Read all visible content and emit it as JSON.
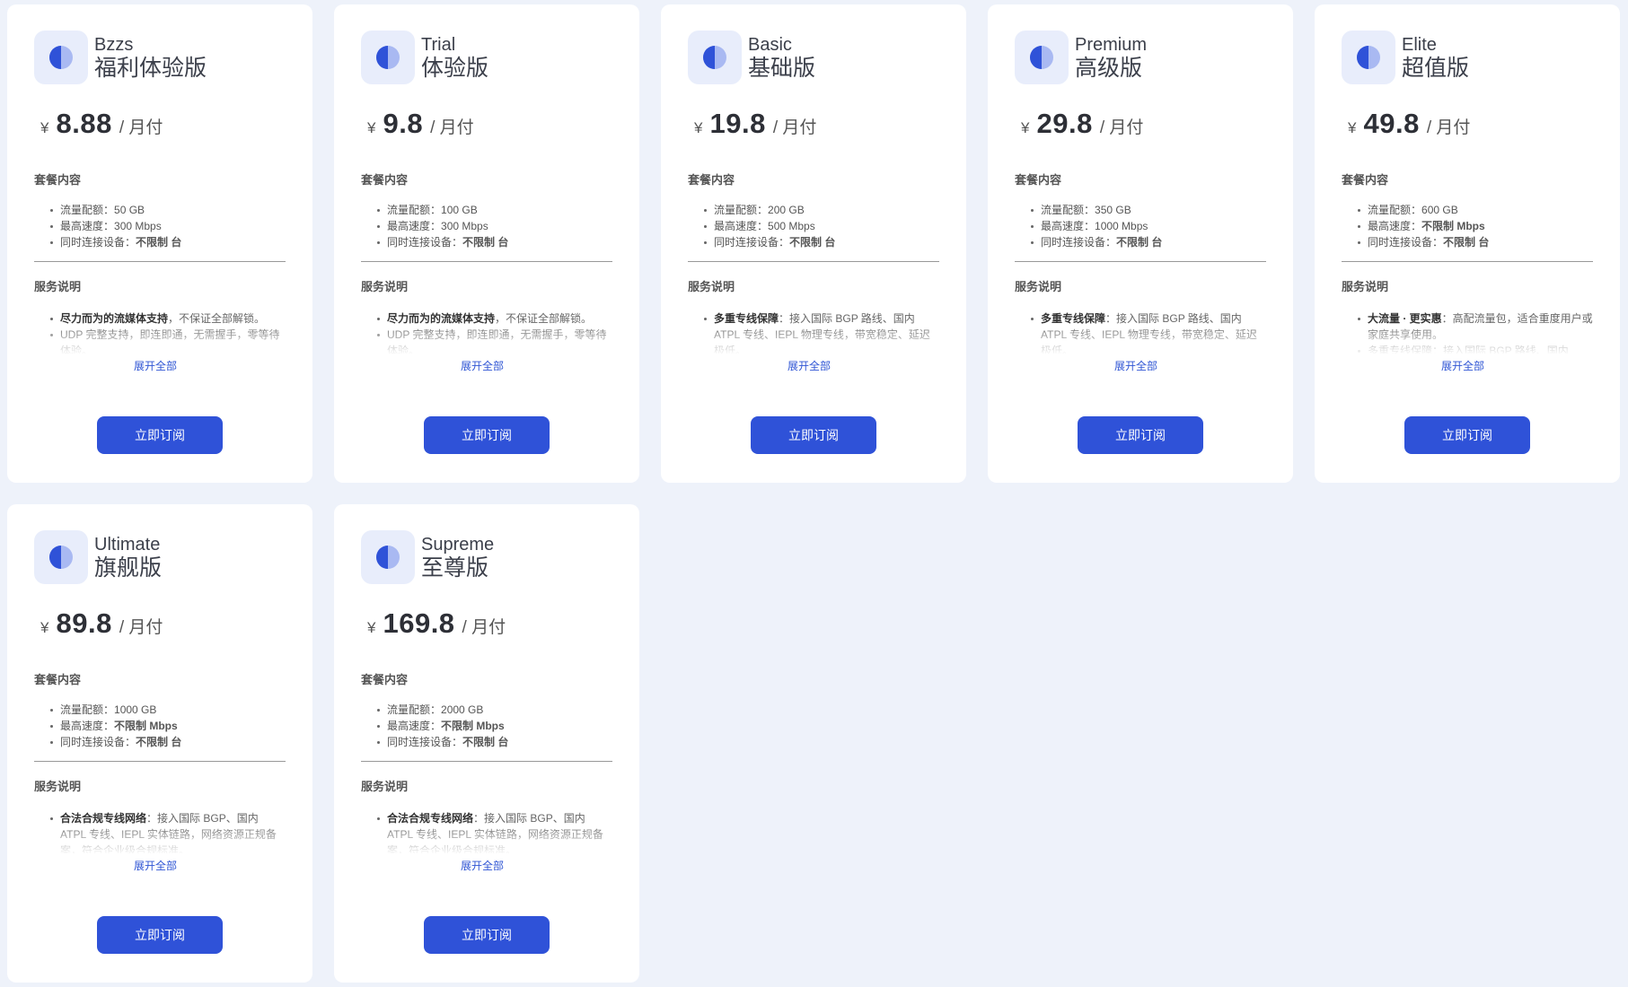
{
  "plans": [
    {
      "name_en": "Bzzs",
      "name_cn": "福利体验版",
      "currency": "¥",
      "price": "8.88",
      "period": "/ 月付",
      "contents_title": "套餐内容",
      "features": [
        {
          "label": "流量配额：",
          "value": "50 GB",
          "strong": false
        },
        {
          "label": "最高速度：",
          "value": "300 Mbps",
          "strong": false
        },
        {
          "label": "同时连接设备：",
          "value": "不限制 台",
          "strong": true
        }
      ],
      "service_title": "服务说明",
      "service_lines": [
        {
          "bold": "尽力而为的流媒体支持",
          "text": "，不保证全部解锁。"
        },
        {
          "bold": "",
          "text": "UDP 完整支持，即连即通，无需握手，零等待体验。"
        }
      ],
      "expand_label": "展开全部",
      "button_label": "立即订阅"
    },
    {
      "name_en": "Trial",
      "name_cn": "体验版",
      "currency": "¥",
      "price": "9.8",
      "period": "/ 月付",
      "contents_title": "套餐内容",
      "features": [
        {
          "label": "流量配额：",
          "value": "100 GB",
          "strong": false
        },
        {
          "label": "最高速度：",
          "value": "300 Mbps",
          "strong": false
        },
        {
          "label": "同时连接设备：",
          "value": "不限制 台",
          "strong": true
        }
      ],
      "service_title": "服务说明",
      "service_lines": [
        {
          "bold": "尽力而为的流媒体支持",
          "text": "，不保证全部解锁。"
        },
        {
          "bold": "",
          "text": "UDP 完整支持，即连即通，无需握手，零等待体验。"
        }
      ],
      "expand_label": "展开全部",
      "button_label": "立即订阅"
    },
    {
      "name_en": "Basic",
      "name_cn": "基础版",
      "currency": "¥",
      "price": "19.8",
      "period": "/ 月付",
      "contents_title": "套餐内容",
      "features": [
        {
          "label": "流量配额：",
          "value": "200 GB",
          "strong": false
        },
        {
          "label": "最高速度：",
          "value": "500 Mbps",
          "strong": false
        },
        {
          "label": "同时连接设备：",
          "value": "不限制 台",
          "strong": true
        }
      ],
      "service_title": "服务说明",
      "service_lines": [
        {
          "bold": "多重专线保障",
          "text": "：接入国际 BGP 路线、国内 ATPL 专线、IEPL 物理专线，带宽稳定、延迟极低。"
        }
      ],
      "expand_label": "展开全部",
      "button_label": "立即订阅"
    },
    {
      "name_en": "Premium",
      "name_cn": "高级版",
      "currency": "¥",
      "price": "29.8",
      "period": "/ 月付",
      "contents_title": "套餐内容",
      "features": [
        {
          "label": "流量配额：",
          "value": "350 GB",
          "strong": false
        },
        {
          "label": "最高速度：",
          "value": "1000 Mbps",
          "strong": false
        },
        {
          "label": "同时连接设备：",
          "value": "不限制 台",
          "strong": true
        }
      ],
      "service_title": "服务说明",
      "service_lines": [
        {
          "bold": "多重专线保障",
          "text": "：接入国际 BGP 路线、国内 ATPL 专线、IEPL 物理专线，带宽稳定、延迟极低。"
        }
      ],
      "expand_label": "展开全部",
      "button_label": "立即订阅"
    },
    {
      "name_en": "Elite",
      "name_cn": "超值版",
      "currency": "¥",
      "price": "49.8",
      "period": "/ 月付",
      "contents_title": "套餐内容",
      "features": [
        {
          "label": "流量配额：",
          "value": "600 GB",
          "strong": false
        },
        {
          "label": "最高速度：",
          "value": "不限制 Mbps",
          "strong": true
        },
        {
          "label": "同时连接设备：",
          "value": "不限制 台",
          "strong": true
        }
      ],
      "service_title": "服务说明",
      "service_lines": [
        {
          "bold": "大流量 · 更实惠",
          "text": "：高配流量包，适合重度用户或家庭共享使用。"
        },
        {
          "bold": "",
          "text": "多重专线保障：接入国际 BGP 路线、国内"
        }
      ],
      "expand_label": "展开全部",
      "button_label": "立即订阅"
    },
    {
      "name_en": "Ultimate",
      "name_cn": "旗舰版",
      "currency": "¥",
      "price": "89.8",
      "period": "/ 月付",
      "contents_title": "套餐内容",
      "features": [
        {
          "label": "流量配额：",
          "value": "1000 GB",
          "strong": false
        },
        {
          "label": "最高速度：",
          "value": "不限制 Mbps",
          "strong": true
        },
        {
          "label": "同时连接设备：",
          "value": "不限制 台",
          "strong": true
        }
      ],
      "service_title": "服务说明",
      "service_lines": [
        {
          "bold": "合法合规专线网络",
          "text": "：接入国际 BGP、国内 ATPL 专线、IEPL 实体链路，网络资源正规备案，符合企业级合规标准。"
        }
      ],
      "expand_label": "展开全部",
      "button_label": "立即订阅"
    },
    {
      "name_en": "Supreme",
      "name_cn": "至尊版",
      "currency": "¥",
      "price": "169.8",
      "period": "/ 月付",
      "contents_title": "套餐内容",
      "features": [
        {
          "label": "流量配额：",
          "value": "2000 GB",
          "strong": false
        },
        {
          "label": "最高速度：",
          "value": "不限制 Mbps",
          "strong": true
        },
        {
          "label": "同时连接设备：",
          "value": "不限制 台",
          "strong": true
        }
      ],
      "service_title": "服务说明",
      "service_lines": [
        {
          "bold": "合法合规专线网络",
          "text": "：接入国际 BGP、国内 ATPL 专线、IEPL 实体链路，网络资源正规备案，符合企业级合规标准。"
        }
      ],
      "expand_label": "展开全部",
      "button_label": "立即订阅"
    }
  ],
  "colors": {
    "accent": "#2f52d8",
    "icon_dark": "#2f52d8",
    "icon_light": "#a9b9f2",
    "background": "#eef2fa",
    "card": "#ffffff",
    "link": "#2f55d4"
  },
  "icons": {
    "plan_icon": "half-circle-icon"
  }
}
